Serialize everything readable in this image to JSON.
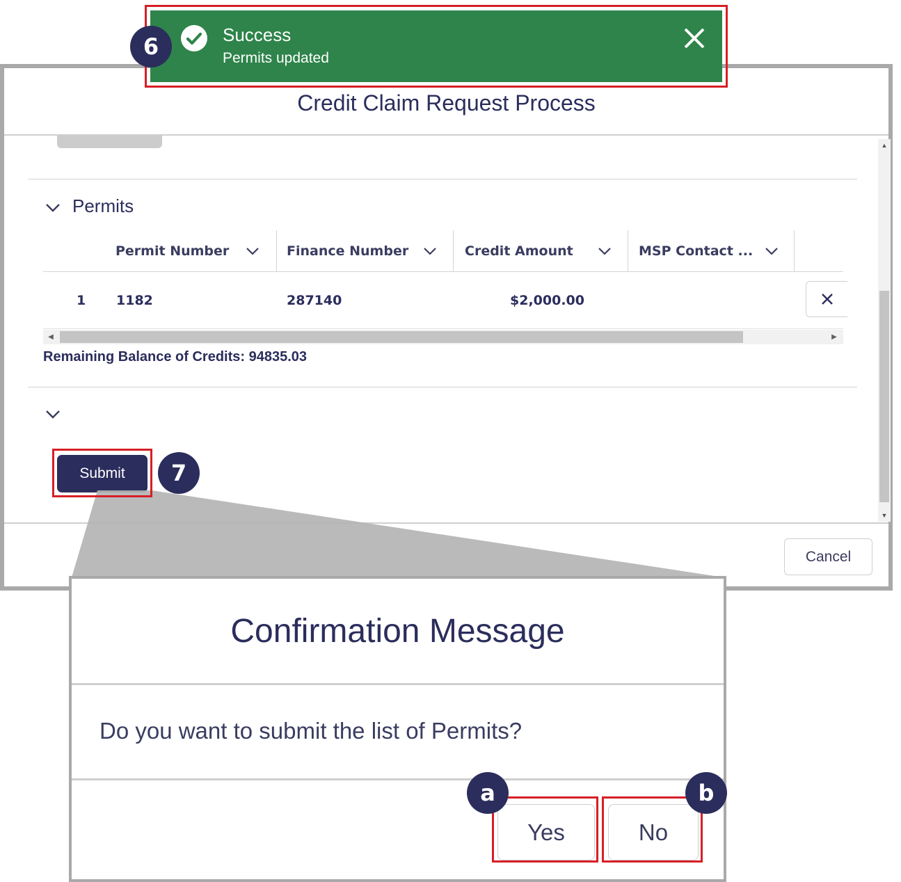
{
  "toast": {
    "title": "Success",
    "message": "Permits updated",
    "icon": "check-circle-icon",
    "close_icon": "close-icon",
    "color": "#2e844a"
  },
  "modal": {
    "title": "Credit Claim Request Process",
    "section_title": "Permits",
    "columns": [
      "Permit Number",
      "Finance Number",
      "Credit Amount",
      "MSP Contact ..."
    ],
    "rows": [
      {
        "index": "1",
        "permit_number": "1182",
        "finance_number": "287140",
        "credit_amount": "$2,000.00",
        "msp_contact": ""
      }
    ],
    "remaining_balance": "Remaining Balance of Credits: 94835.03",
    "submit_label": "Submit",
    "cancel_label": "Cancel"
  },
  "confirmation": {
    "title": "Confirmation Message",
    "message": "Do you want to submit the list of Permits?",
    "yes_label": "Yes",
    "no_label": "No"
  },
  "callouts": {
    "toast_step": "6",
    "submit_step": "7",
    "yes_step": "a",
    "no_step": "b"
  },
  "colors": {
    "primary": "#2b2d5c",
    "success": "#2e844a",
    "highlight": "#d61f26"
  }
}
